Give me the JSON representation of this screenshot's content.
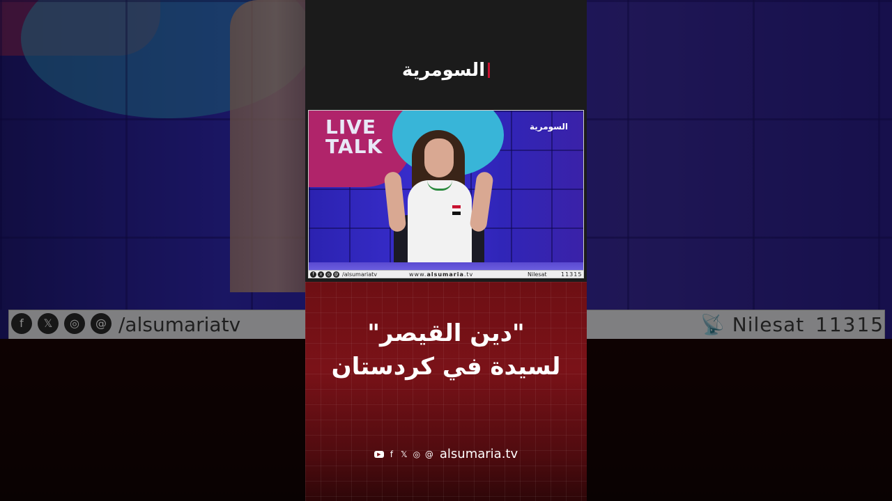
{
  "brand": {
    "name": "السومرية"
  },
  "video": {
    "show_title_line1": "LIVE",
    "show_title_line2": "TALK",
    "channel_logo": "السومرية",
    "ticker": {
      "handle": "/alsumariatv",
      "website_prefix": "www.",
      "website_bold": "alsumaria",
      "website_suffix": ".tv",
      "satellite": "Nilesat",
      "frequency": "11315"
    }
  },
  "background_ticker": {
    "handle": "/alsumariatv",
    "satellite": "Nilesat",
    "frequency": "11315"
  },
  "headline": {
    "line1": "\"دين القيصر\"",
    "line2": "لسيدة في كردستان"
  },
  "footer": {
    "website": "alsumaria.tv",
    "icons": [
      "youtube-icon",
      "facebook-icon",
      "x-icon",
      "instagram-icon",
      "threads-icon"
    ]
  },
  "colors": {
    "accent_red": "#c8102e",
    "card_bottom": "#7a1218",
    "studio_blue": "#3a2fd0"
  }
}
